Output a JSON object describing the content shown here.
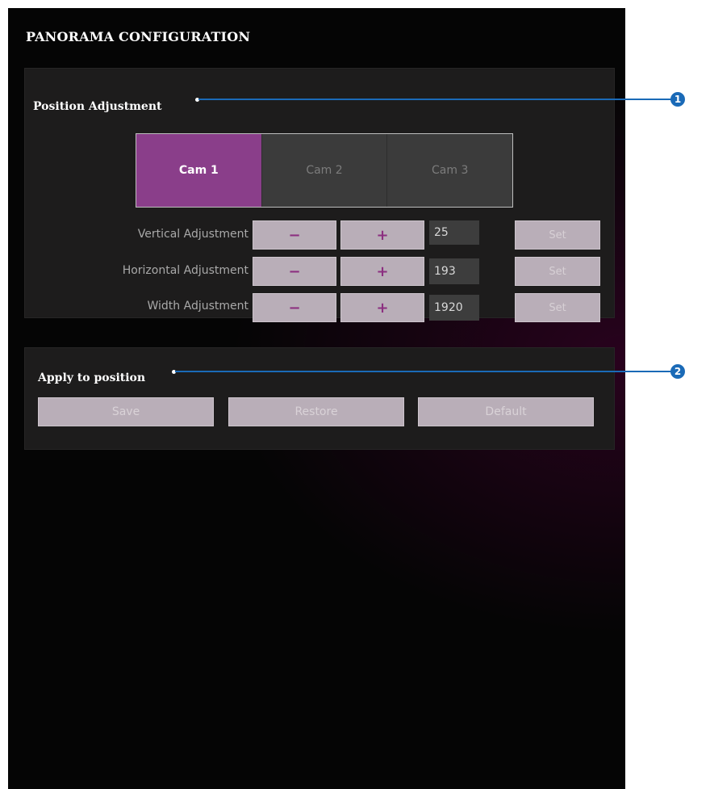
{
  "page": {
    "title": "PANORAMA CONFIGURATION"
  },
  "position_adjustment": {
    "title": "Position Adjustment",
    "tabs": [
      {
        "label": "Cam 1",
        "active": true
      },
      {
        "label": "Cam 2",
        "active": false
      },
      {
        "label": "Cam 3",
        "active": false
      }
    ],
    "rows": [
      {
        "label": "Vertical Adjustment",
        "minus": "−",
        "plus": "+",
        "value": "25",
        "set": "Set"
      },
      {
        "label": "Horizontal Adjustment",
        "minus": "−",
        "plus": "+",
        "value": "193",
        "set": "Set"
      },
      {
        "label": "Width Adjustment",
        "minus": "−",
        "plus": "+",
        "value": "1920",
        "set": "Set"
      }
    ]
  },
  "apply_to_position": {
    "title": "Apply to position",
    "buttons": {
      "save": "Save",
      "restore": "Restore",
      "default": "Default"
    }
  },
  "callouts": [
    "1",
    "2"
  ],
  "colors": {
    "accent": "#8a3e8a",
    "callout": "#1a6ab7",
    "button": "#b9aeb8"
  }
}
